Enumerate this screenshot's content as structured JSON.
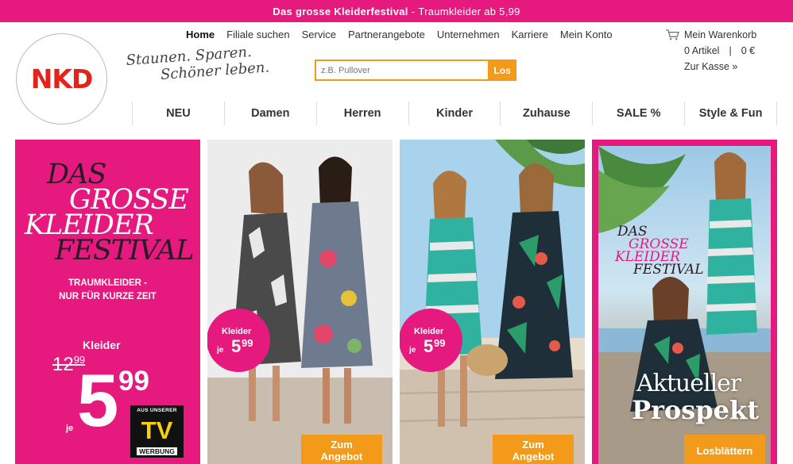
{
  "promo": {
    "title": "Das grosse Kleiderfestival",
    "sep": " - ",
    "subtitle": "Traumkleider ab 5,99"
  },
  "logo": {
    "text": "NKD",
    "color": "#e2231a"
  },
  "slogan": {
    "line1": "Staunen. Sparen.",
    "line2": "Schöner leben."
  },
  "topnav": [
    "Home",
    "Filiale suchen",
    "Service",
    "Partnerangebote",
    "Unternehmen",
    "Karriere",
    "Mein Konto"
  ],
  "search": {
    "placeholder": "z.B. Pullover",
    "button": "Los"
  },
  "cart": {
    "title": "Mein Warenkorb",
    "items": "0 Artikel",
    "separator": "|",
    "total": "0 €",
    "checkout": "Zur Kasse »",
    "icon": "cart-icon"
  },
  "mainnav": [
    "NEU",
    "Damen",
    "Herren",
    "Kinder",
    "Zuhause",
    "SALE %",
    "Style & Fun"
  ],
  "tile1": {
    "title_l1": "DAS",
    "title_l2": "GROSSE",
    "title_l3": "KLEIDER",
    "title_l4": "FESTIVAL",
    "subtitle_l1": "TRAUMKLEIDER -",
    "subtitle_l2": "NUR FÜR KURZE ZEIT",
    "label": "Kleider",
    "old_price_main": "12",
    "old_price_cents": "99",
    "je": "je",
    "price_main": "5",
    "price_cents": "99",
    "badge_top": "AUS UNSERER",
    "badge_logo": "TV",
    "badge_bottom": "WERBUNG"
  },
  "tile2": {
    "bubble_label": "Kleider",
    "bubble_je": "je",
    "bubble_price": "5",
    "bubble_cents": "99",
    "cta_l1": "Zum",
    "cta_l2": "Angebot"
  },
  "tile3": {
    "bubble_label": "Kleider",
    "bubble_je": "je",
    "bubble_price": "5",
    "bubble_cents": "99",
    "cta_l1": "Zum",
    "cta_l2": "Angebot"
  },
  "tile4": {
    "title_l1": "DAS",
    "title_l2": "GROSSE",
    "title_l3": "KLEIDER",
    "title_l4": "FESTIVAL",
    "headline_l1": "Aktueller",
    "headline_l2": "Prospekt",
    "cta": "Losblättern"
  },
  "colors": {
    "brand_pink": "#e6197e",
    "cta_orange": "#f39a1a",
    "logo_red": "#e2231a"
  }
}
